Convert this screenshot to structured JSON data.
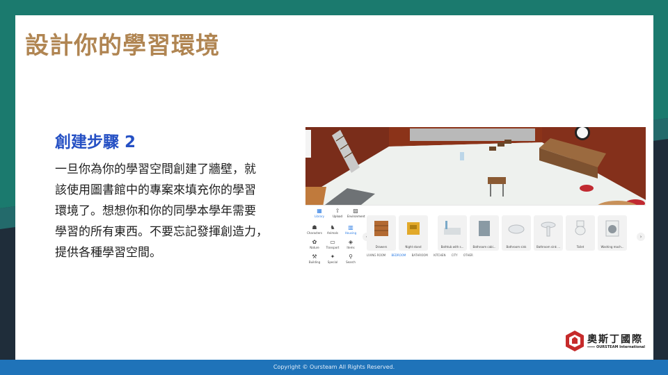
{
  "slide": {
    "title": "設計你的學習環境",
    "step_heading": "創建步驟 2",
    "body_lines": [
      "一旦你為你的學習空間創建了牆壁，就",
      "該使用圖書館中的專案來填充你的學習",
      "環境了。想想你和你的同學本學年需要",
      "學習的所有東西。不要忘記發揮創造力，",
      "提供各種學習空間。"
    ],
    "footer": "Copyright © Oursteam All Rights Reserved.",
    "logo_cn": "奧斯丁國際",
    "logo_en": "OURSTEAM International"
  },
  "colors": {
    "title": "#b08552",
    "heading": "#2550c4",
    "footer_bar": "#1f73b9",
    "teal": "#1b7a6e",
    "navy": "#1f2d3a",
    "accent": "#2a7be4"
  },
  "editor": {
    "top_tabs": [
      {
        "label": "Library",
        "icon": "library-icon"
      },
      {
        "label": "Upload",
        "icon": "upload-icon"
      },
      {
        "label": "Environment",
        "icon": "environment-icon"
      }
    ],
    "categories": [
      {
        "label": "Characters",
        "icon": "characters-icon"
      },
      {
        "label": "Animals",
        "icon": "animals-icon"
      },
      {
        "label": "Housing",
        "icon": "housing-icon"
      },
      {
        "label": "Nature",
        "icon": "nature-icon"
      },
      {
        "label": "Transport",
        "icon": "transport-icon"
      },
      {
        "label": "Items",
        "icon": "items-icon"
      },
      {
        "label": "Building",
        "icon": "building-icon"
      },
      {
        "label": "Special",
        "icon": "special-icon"
      },
      {
        "label": "Search",
        "icon": "search-icon"
      }
    ],
    "items": [
      {
        "label": "Drawers"
      },
      {
        "label": "Night stand"
      },
      {
        "label": "Bathtub with s..."
      },
      {
        "label": "Bathroom cabi..."
      },
      {
        "label": "Bathroom sink"
      },
      {
        "label": "Bathroom sink ..."
      },
      {
        "label": "Toilet"
      },
      {
        "label": "Washing mach..."
      }
    ],
    "rooms": [
      "LIVING ROOM",
      "BEDROOM",
      "BATHROOM",
      "KITCHEN",
      "CITY",
      "OTHER"
    ]
  }
}
